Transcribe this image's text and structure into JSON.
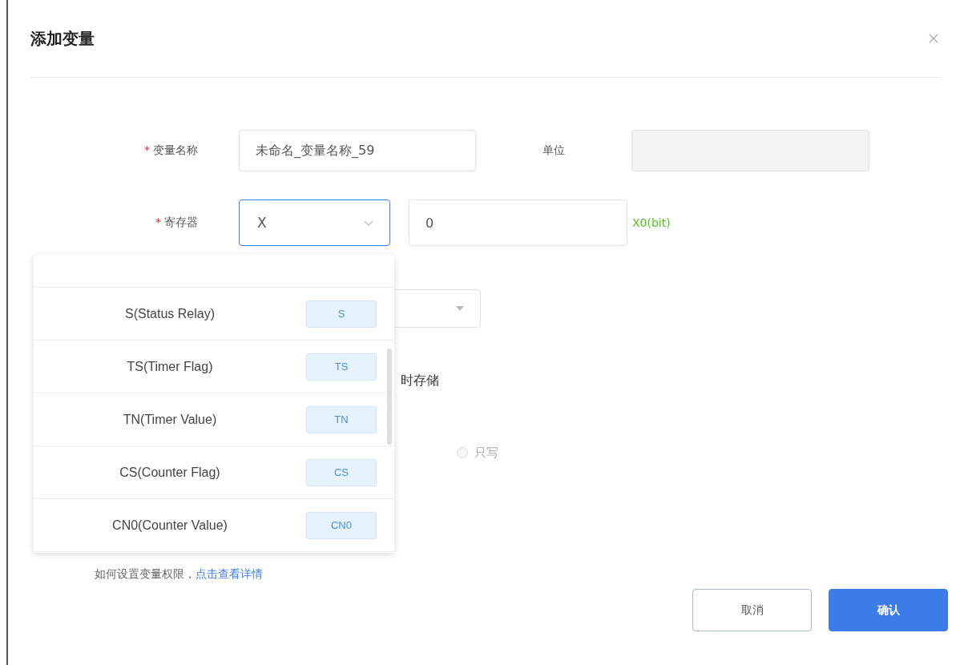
{
  "dialog": {
    "title": "添加变量"
  },
  "name_row": {
    "marker": "*",
    "label": "变量名称",
    "value": "未命名_变量名称_59",
    "unit_label": "单位"
  },
  "register_row": {
    "marker": "*",
    "label": "寄存器",
    "register": "X",
    "address": "0",
    "hint": "X0(bit)"
  },
  "register_options": [
    {
      "label": "S(Status Relay)",
      "tag": "S"
    },
    {
      "label": "TS(Timer Flag)",
      "tag": "TS"
    },
    {
      "label": "TN(Timer Value)",
      "tag": "TN"
    },
    {
      "label": "CS(Counter Flag)",
      "tag": "CS"
    },
    {
      "label": "CN0(Counter Value)",
      "tag": "CN0"
    }
  ],
  "storage_text": "时存储",
  "access_options": [
    {
      "label": "只写",
      "selected": false
    }
  ],
  "help": {
    "text": "如何设置变量权限，",
    "link": "点击查看详情"
  },
  "buttons": [
    {
      "kind": "secondary",
      "label": "取消"
    },
    {
      "kind": "primary",
      "label": "确认"
    }
  ]
}
